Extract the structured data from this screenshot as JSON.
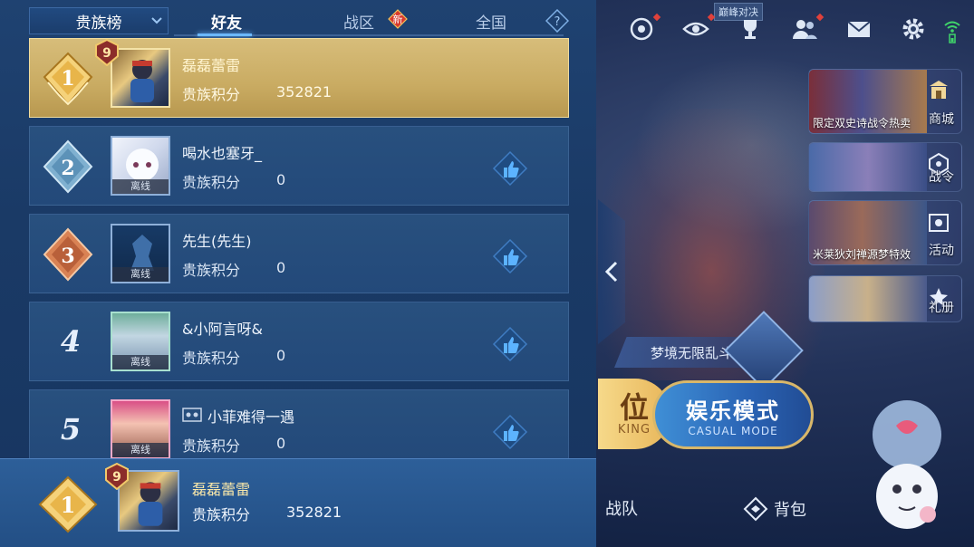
{
  "tabs": {
    "dropdown_label": "贵族榜",
    "friends": "好友",
    "zone": "战区",
    "zone_badge": "新",
    "nation": "全国",
    "help": "?"
  },
  "leaderboard": [
    {
      "rank": "1",
      "level": "9",
      "name": "磊磊蕾雷",
      "score_label": "贵族积分",
      "score": "352821",
      "status": ""
    },
    {
      "rank": "2",
      "level": "",
      "name": "喝水也塞牙_",
      "score_label": "贵族积分",
      "score": "0",
      "status": "离线"
    },
    {
      "rank": "3",
      "level": "",
      "name": "先生(先生)",
      "score_label": "贵族积分",
      "score": "0",
      "status": "离线"
    },
    {
      "rank": "4",
      "level": "",
      "name": "&小阿言呀&",
      "score_label": "贵族积分",
      "score": "0",
      "status": "离线"
    },
    {
      "rank": "5",
      "level": "",
      "name": "小菲难得一遇",
      "score_label": "贵族积分",
      "score": "0",
      "status": "离线"
    }
  ],
  "self": {
    "rank": "1",
    "level": "9",
    "name": "磊磊蕾雷",
    "score_label": "贵族积分",
    "score": "352821"
  },
  "right": {
    "peak_label": "巅峰对决",
    "shop_caption": "限定双史诗战令热卖",
    "shop_label": "商城",
    "battlepass_label": "战令",
    "event_caption": "米莱狄刘禅源梦特效",
    "event_label": "活动",
    "book_label": "礼册",
    "dream_mode": "梦境无限乱斗",
    "rank_mode_big": "位",
    "rank_mode_small": "KING",
    "casual_big": "娱乐模式",
    "casual_small": "CASUAL MODE",
    "team_label": "战队",
    "bag_label": "背包"
  },
  "colors": {
    "panel": "#1f4271",
    "gold_row": "#d7bd7a",
    "accent": "#6bb8ff",
    "like": "#4aa6f0"
  }
}
